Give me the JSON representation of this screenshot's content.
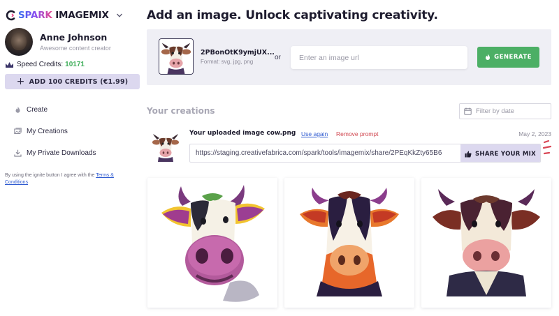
{
  "brand": {
    "logo_spark": "SPARK",
    "logo_mix": "IMAGEMIX",
    "colors": {
      "spark_gradient_start": "#2f6cf0",
      "spark_gradient_end": "#e94a8b",
      "accent_green": "#4caf65",
      "accent_purple": "#dcd8ef"
    }
  },
  "user": {
    "name": "Anne Johnson",
    "role": "Awesome content creator"
  },
  "credits": {
    "label": "Speed Credits:",
    "value": "10171",
    "add_button": "ADD 100 CREDITS (€1.99)"
  },
  "nav": {
    "items": [
      {
        "label": "Create",
        "icon": "flame-icon"
      },
      {
        "label": "My Creations",
        "icon": "gallery-icon"
      },
      {
        "label": "My Private Downloads",
        "icon": "download-icon"
      }
    ]
  },
  "terms": {
    "prefix": "By using the ignite button I agree with the ",
    "link": "Terms & Conditions"
  },
  "header": {
    "title": "Add an image. Unlock captivating creativity."
  },
  "upload": {
    "file_name": "2PBonOtK9ymjUX...",
    "format_hint": "Format: svg, jpg, png",
    "or_label": "or",
    "url_placeholder": "Enter an image url",
    "generate_label": "GENERATE"
  },
  "creations": {
    "section_title": "Your creations",
    "filter_placeholder": "Filter by date",
    "item": {
      "title": "Your uploaded image cow.png",
      "use_again": "Use again",
      "remove_prompt": "Remove prompt",
      "date": "May 2, 2023",
      "share_url": "https://staging.creativefabrica.com/spark/tools/imagemix/share/2PEqKkZty65B6",
      "share_button": "SHARE YOUR MIX"
    },
    "results_count": 3
  }
}
